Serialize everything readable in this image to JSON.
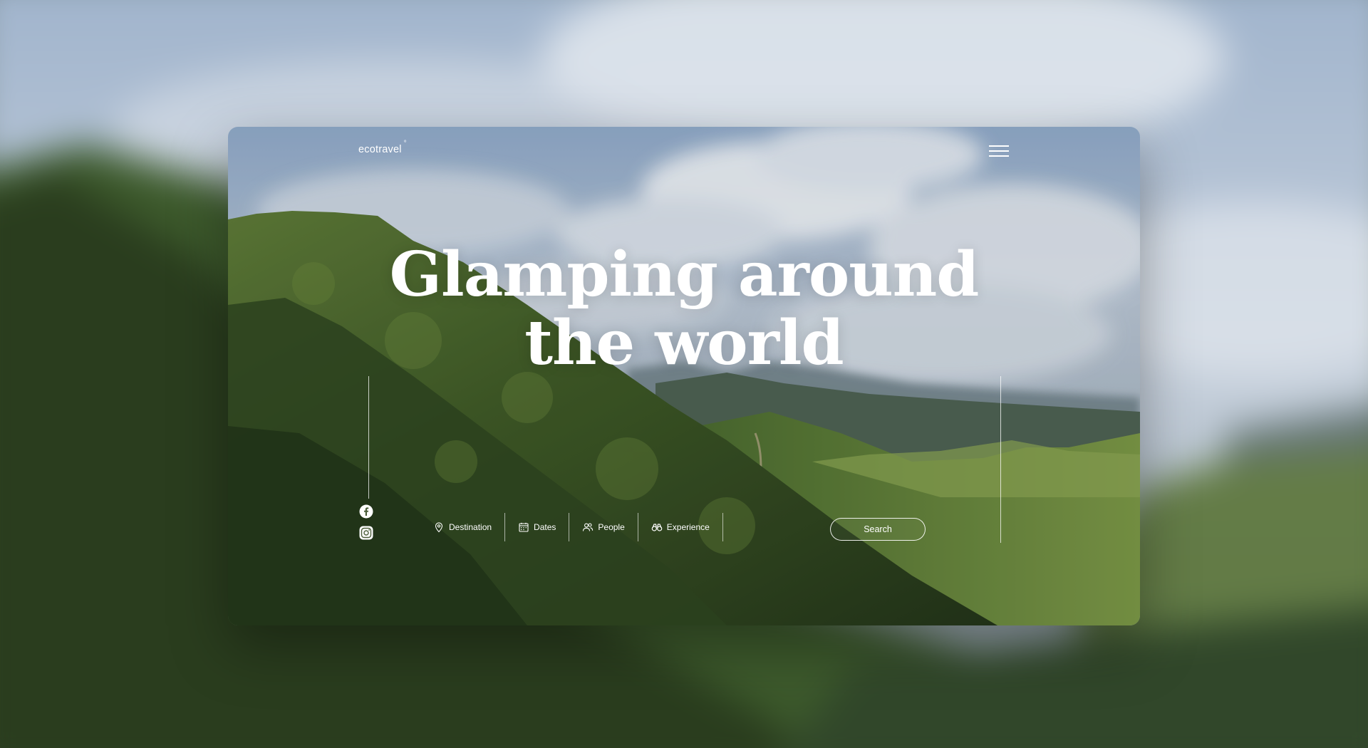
{
  "brand": {
    "logo_text": "ecotravel",
    "logo_mark": "°"
  },
  "hero": {
    "headline_line1": "Glamping around",
    "headline_line2": "the world"
  },
  "social": [
    {
      "name": "facebook-icon"
    },
    {
      "name": "instagram-icon"
    }
  ],
  "search": {
    "fields": [
      {
        "label": "Destination",
        "icon": "location-pin-icon"
      },
      {
        "label": "Dates",
        "icon": "calendar-icon"
      },
      {
        "label": "People",
        "icon": "people-icon"
      },
      {
        "label": "Experience",
        "icon": "binoculars-icon"
      }
    ],
    "button_label": "Search"
  },
  "colors": {
    "text": "#ffffff",
    "hill_dark": "#2f4424",
    "hill_light": "#5f7a3a",
    "sky": "#b8c6d6"
  }
}
